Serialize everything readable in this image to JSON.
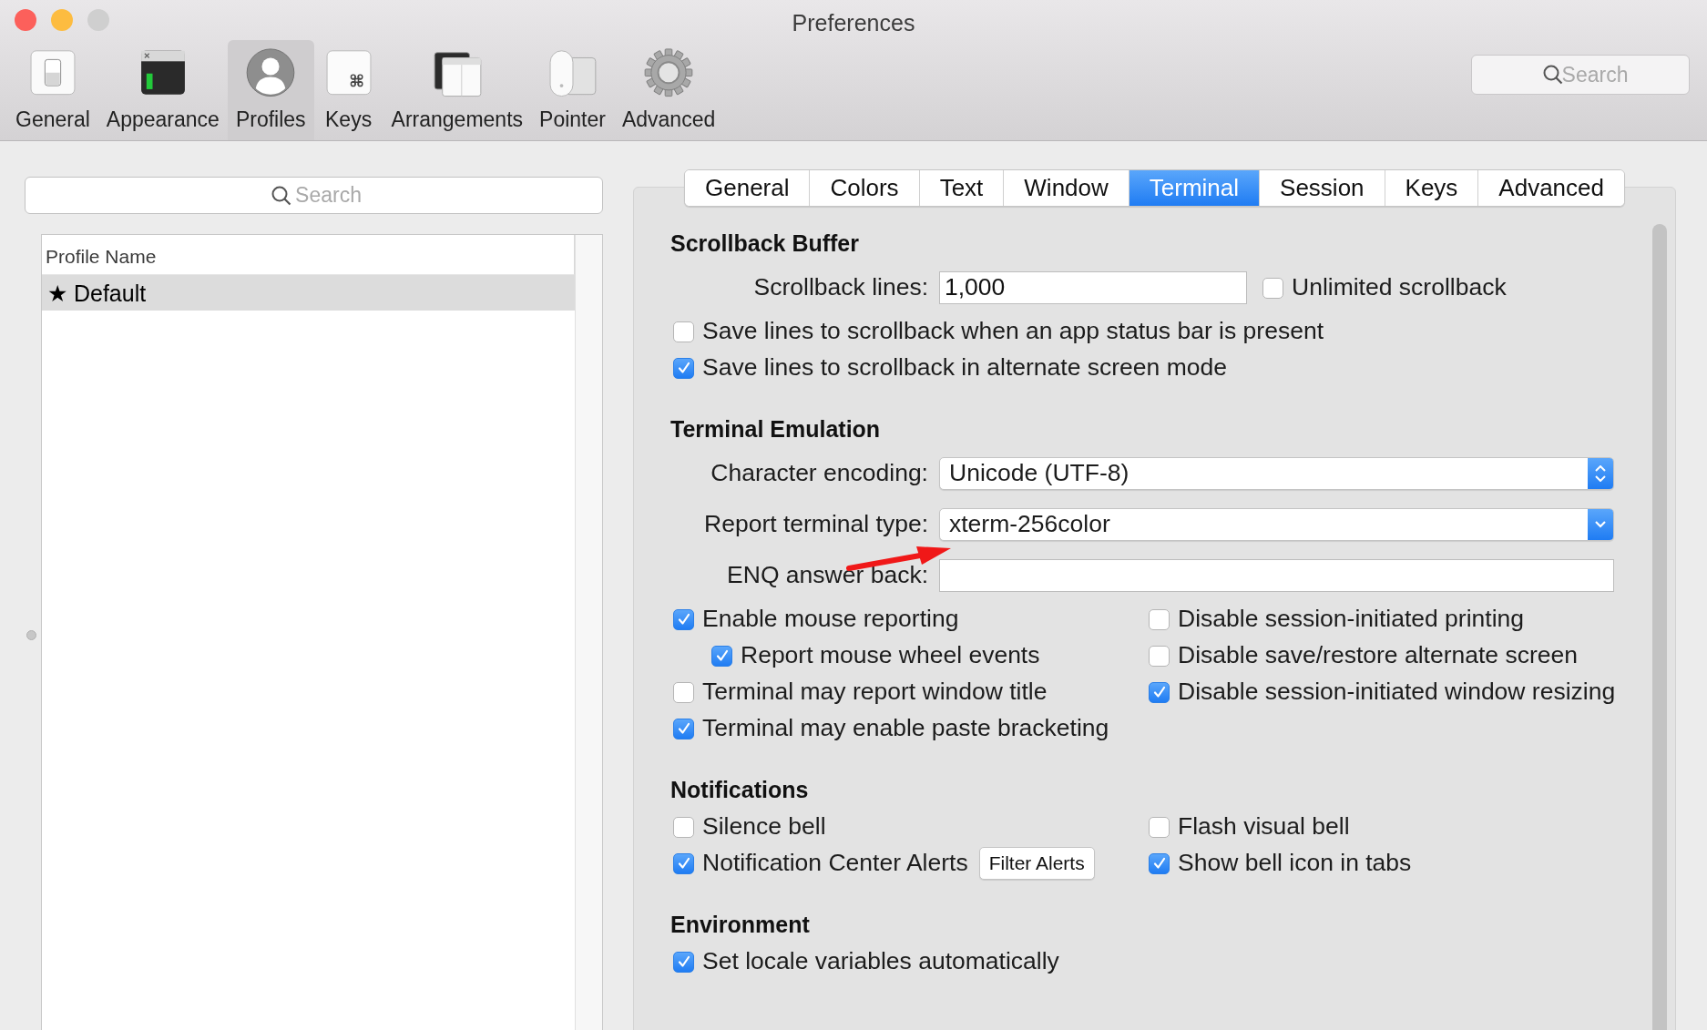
{
  "window": {
    "title": "Preferences"
  },
  "toolbar": {
    "items": [
      {
        "label": "General",
        "kind": "general",
        "selected": false
      },
      {
        "label": "Appearance",
        "kind": "appearance",
        "selected": false
      },
      {
        "label": "Profiles",
        "kind": "profiles",
        "selected": true
      },
      {
        "label": "Keys",
        "kind": "keys",
        "selected": false
      },
      {
        "label": "Arrangements",
        "kind": "arrangements",
        "selected": false
      },
      {
        "label": "Pointer",
        "kind": "pointer",
        "selected": false
      },
      {
        "label": "Advanced",
        "kind": "advanced",
        "selected": false
      }
    ],
    "search": {
      "placeholder": "Search"
    }
  },
  "profiles": {
    "search": {
      "placeholder": "Search"
    },
    "columns": [
      "Profile Name"
    ],
    "rows": [
      {
        "star": "★",
        "name": "Default",
        "selected": true
      }
    ]
  },
  "tabs": [
    {
      "label": "General",
      "selected": false
    },
    {
      "label": "Colors",
      "selected": false
    },
    {
      "label": "Text",
      "selected": false
    },
    {
      "label": "Window",
      "selected": false
    },
    {
      "label": "Terminal",
      "selected": true
    },
    {
      "label": "Session",
      "selected": false
    },
    {
      "label": "Keys",
      "selected": false
    },
    {
      "label": "Advanced",
      "selected": false
    }
  ],
  "sections": [
    {
      "title": "Scrollback Buffer",
      "rows": [
        {
          "kind": "field",
          "label": "Scrollback lines:",
          "value": "1,000",
          "side": {
            "label": "Unlimited scrollback",
            "checked": false
          }
        },
        {
          "kind": "check",
          "label": "Save lines to scrollback when an app status bar is present",
          "checked": false
        },
        {
          "kind": "check",
          "label": "Save lines to scrollback in alternate screen mode",
          "checked": true
        }
      ]
    },
    {
      "title": "Terminal Emulation",
      "rows": [
        {
          "kind": "stepper",
          "label": "Character encoding:",
          "value": "Unicode (UTF-8)"
        },
        {
          "kind": "popup",
          "label": "Report terminal type:",
          "value": "xterm-256color"
        },
        {
          "kind": "field",
          "label": "ENQ answer back:",
          "value": ""
        },
        {
          "kind": "columns",
          "left": [
            {
              "label": "Enable mouse reporting",
              "checked": true,
              "children": [
                {
                  "label": "Report mouse wheel events",
                  "checked": true
                }
              ]
            },
            {
              "label": "Terminal may report window title",
              "checked": false
            },
            {
              "label": "Terminal may enable paste bracketing",
              "checked": true
            }
          ],
          "right": [
            {
              "label": "Disable session-initiated printing",
              "checked": false
            },
            {
              "label": "Disable save/restore alternate screen",
              "checked": false
            },
            {
              "label": "Disable session-initiated window resizing",
              "checked": true
            }
          ]
        }
      ]
    },
    {
      "title": "Notifications",
      "rows": [
        {
          "kind": "columns",
          "left": [
            {
              "label": "Silence bell",
              "checked": false
            },
            {
              "label": "Notification Center Alerts",
              "checked": true,
              "button": "Filter Alerts"
            }
          ],
          "right": [
            {
              "label": "Flash visual bell",
              "checked": false
            },
            {
              "label": "Show bell icon in tabs",
              "checked": true
            }
          ]
        }
      ]
    },
    {
      "title": "Environment",
      "rows": [
        {
          "kind": "check",
          "label": "Set locale variables automatically",
          "checked": true
        }
      ]
    }
  ]
}
